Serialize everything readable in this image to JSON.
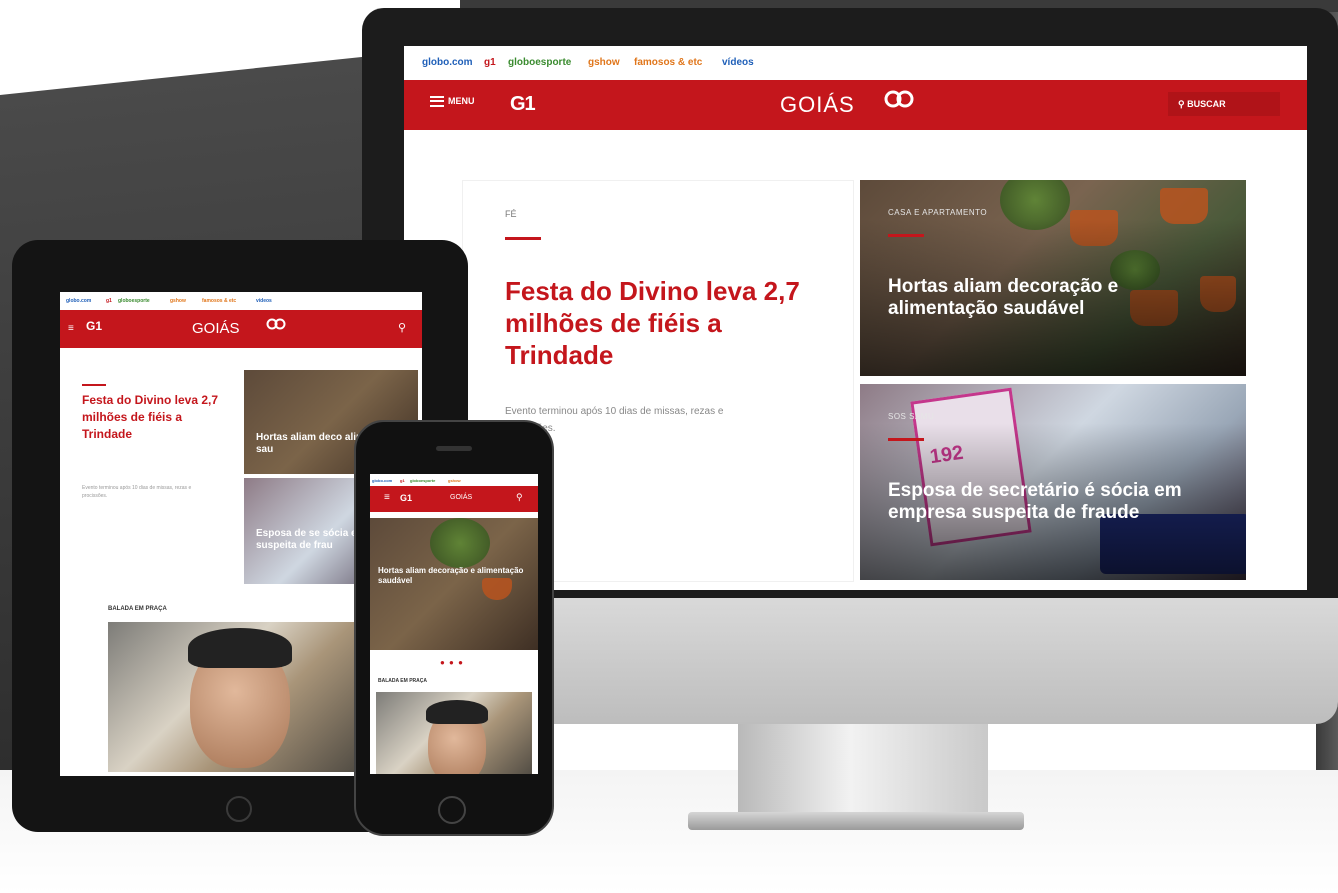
{
  "topbar": {
    "links": [
      "globo.com",
      "g1",
      "globoesporte",
      "gshow",
      "famosos & etc",
      "vídeos"
    ],
    "link_colors": [
      "#1f5fb8",
      "#c4161c",
      "#3a8b2f",
      "#e0761b",
      "#e0761b",
      "#1f5fb8"
    ]
  },
  "header": {
    "menu_label": "MENU",
    "g1_logo": "G1",
    "region": "GOIÁS",
    "tv_logo": "ꟻ",
    "search_label": "BUSCAR"
  },
  "lead": {
    "section": "FÉ",
    "title": "Festa do Divino leva 2,7 milhões de fiéis a Trindade",
    "summary": "Evento terminou após 10 dias de missas, rezas e procissões."
  },
  "cards": [
    {
      "section": "CASA E APARTAMENTO",
      "title": "Hortas aliam decoração e alimentação saudável"
    },
    {
      "section": "SOS SAMU",
      "title": "Esposa de secretário é sócia em empresa suspeita de fraude"
    }
  ],
  "samu_number": "192",
  "tablet": {
    "lead_title": "Festa do Divino leva 2,7 milhões de fiéis a Trindade",
    "lead_summary": "Evento terminou após 10 dias de missas, rezas e procissões.",
    "card1_title": "Hortas aliam deco alimentação sau",
    "card2_title": "Esposa de se sócia em empr suspeita de frau",
    "video_section": "BALADA EM PRAÇA"
  },
  "phone": {
    "card_title": "Hortas aliam decoração e alimentação saudável",
    "dots": "● ● ●",
    "video_section": "BALADA EM PRAÇA"
  },
  "colors": {
    "brand_red": "#c4161c",
    "samu_pink": "#c4378c"
  }
}
